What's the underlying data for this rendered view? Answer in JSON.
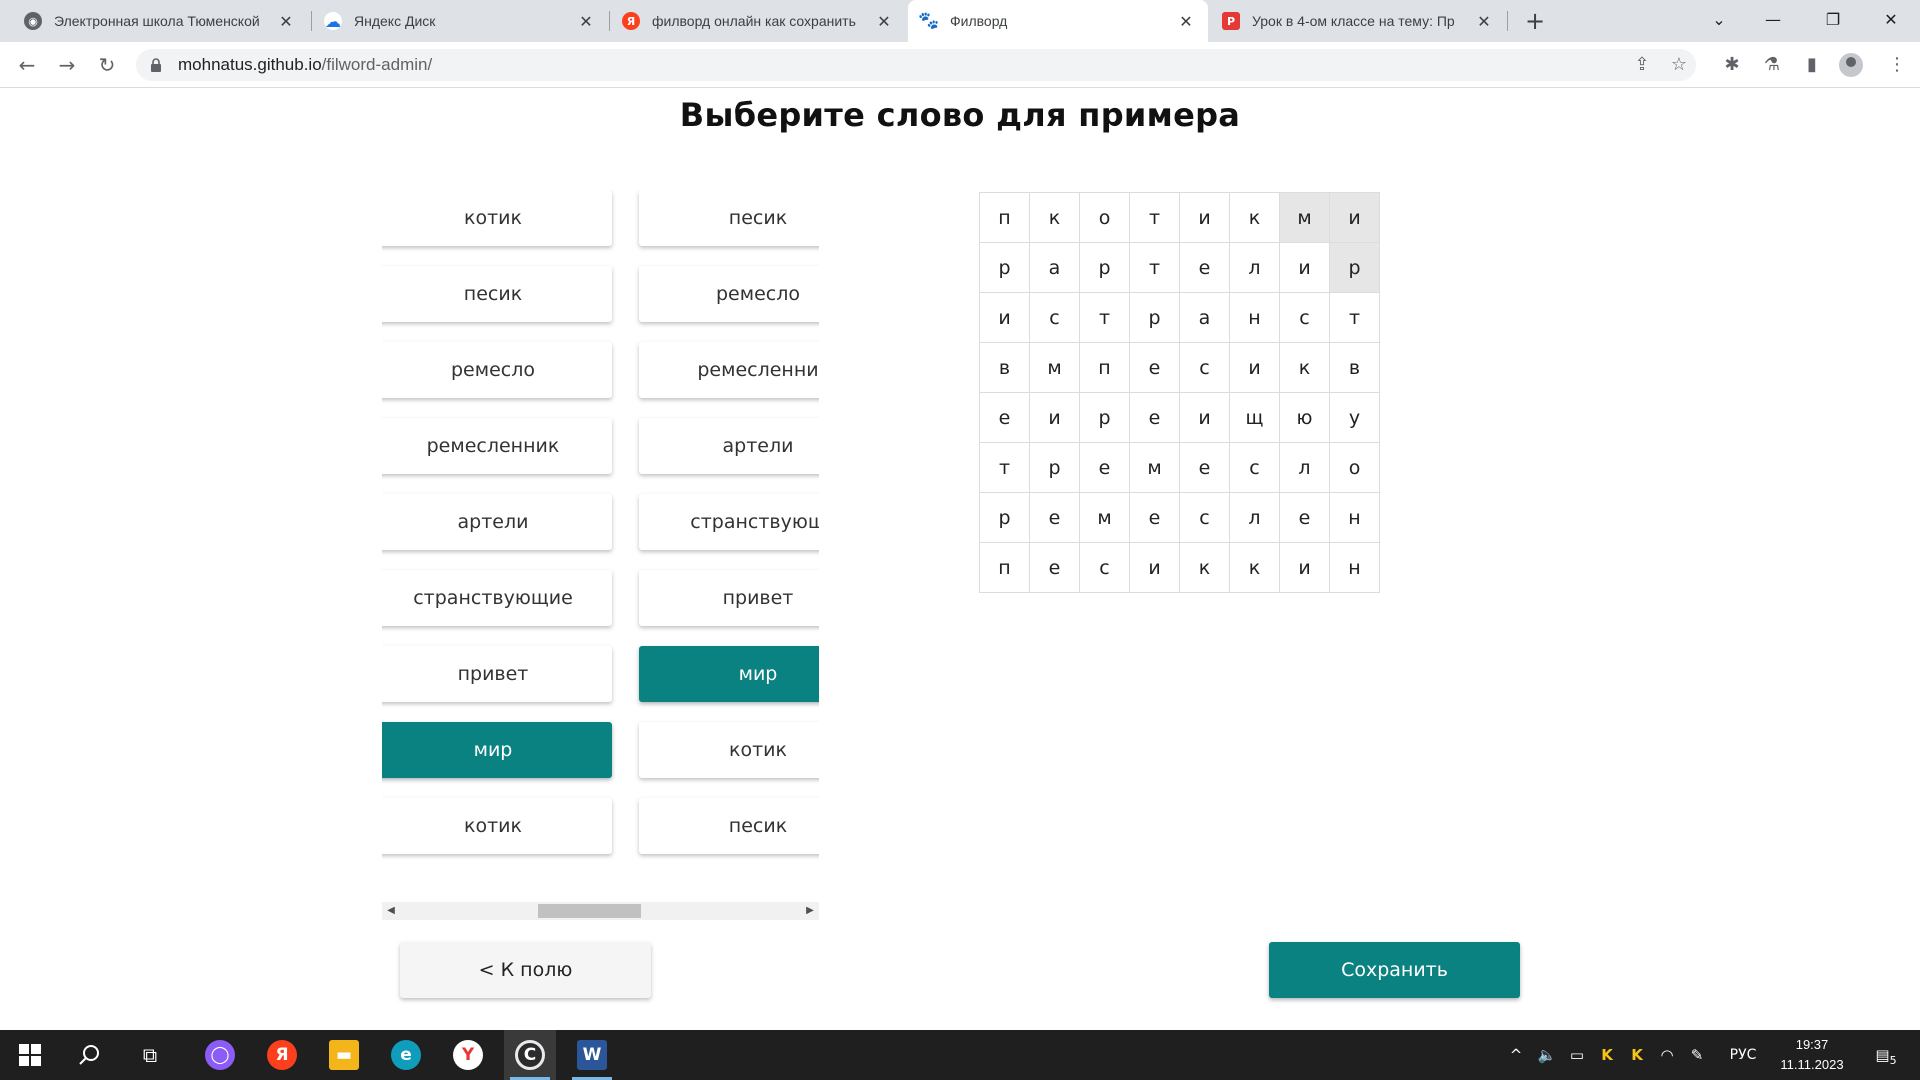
{
  "browser": {
    "tabs": [
      {
        "title": "Электронная школа Тюменской",
        "favicon": "globe-icon",
        "favicon_color": "#5f6368",
        "active": false
      },
      {
        "title": "Яндекс Диск",
        "favicon": "yandex-disk-icon",
        "favicon_color": "#1a73e8",
        "active": false
      },
      {
        "title": "филворд онлайн как сохранить",
        "favicon": "yandex-icon",
        "favicon_color": "#fc3f1d",
        "active": false
      },
      {
        "title": "Филворд",
        "favicon": "paw-icon",
        "favicon_color": "#202124",
        "active": true
      },
      {
        "title": "Урок в 4-ом классе на тему: Пр",
        "favicon": "infourok-icon",
        "favicon_color": "#e53935",
        "active": false
      }
    ],
    "url_host": "mohnatus.github.io",
    "url_path": "/filword-admin/"
  },
  "page": {
    "title": "Выберите слово для примера",
    "accent_color": "#0b8282",
    "word_columns": [
      [
        "котик",
        "песик",
        "ремесло",
        "ремесленник",
        "артели",
        "странствующие",
        "привет",
        "мир",
        "котик"
      ],
      [
        "песик",
        "ремесло",
        "ремесленни",
        "артели",
        "странствующ",
        "привет",
        "мир",
        "котик",
        "песик"
      ]
    ],
    "selected_word": "мир",
    "grid": [
      [
        "п",
        "к",
        "о",
        "т",
        "и",
        "к",
        "м",
        "и"
      ],
      [
        "р",
        "а",
        "р",
        "т",
        "е",
        "л",
        "и",
        "р"
      ],
      [
        "и",
        "с",
        "т",
        "р",
        "а",
        "н",
        "с",
        "т"
      ],
      [
        "в",
        "м",
        "п",
        "е",
        "с",
        "и",
        "к",
        "в"
      ],
      [
        "е",
        "и",
        "р",
        "е",
        "и",
        "щ",
        "ю",
        "у"
      ],
      [
        "т",
        "р",
        "е",
        "м",
        "е",
        "с",
        "л",
        "о"
      ],
      [
        "р",
        "е",
        "м",
        "е",
        "с",
        "л",
        "е",
        "н"
      ],
      [
        "п",
        "е",
        "с",
        "и",
        "к",
        "к",
        "и",
        "н"
      ]
    ],
    "highlighted_cells": [
      [
        0,
        6
      ],
      [
        0,
        7
      ],
      [
        1,
        7
      ]
    ],
    "back_label": "<  К полю",
    "save_label": "Сохранить"
  },
  "taskbar": {
    "time": "19:37",
    "date": "11.11.2023",
    "language": "РУС",
    "notifications": "5"
  }
}
